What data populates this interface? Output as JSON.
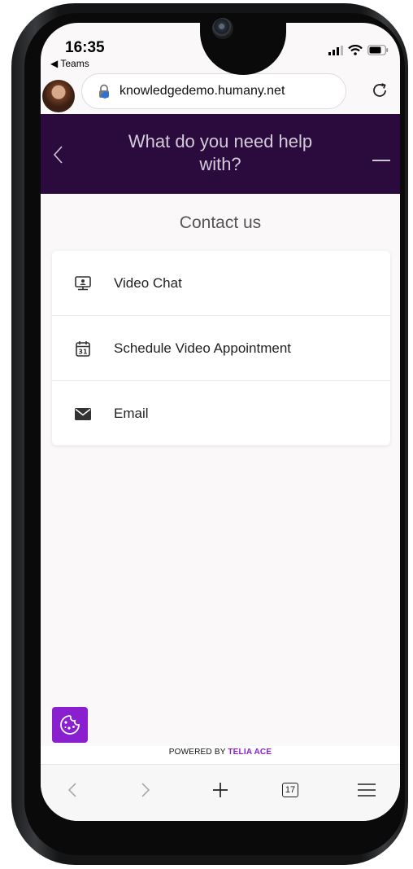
{
  "status_bar": {
    "time": "16:35",
    "back_app": "◀ Teams"
  },
  "browser": {
    "url": "knowledgedemo.humany.net",
    "tab_count": "17"
  },
  "header": {
    "title": "What do you need help with?"
  },
  "contact": {
    "title": "Contact us",
    "options": [
      {
        "label": "Video Chat",
        "icon": "video-chat-icon"
      },
      {
        "label": "Schedule Video Appointment",
        "icon": "calendar-icon"
      },
      {
        "label": "Email",
        "icon": "envelope-icon"
      }
    ]
  },
  "footer": {
    "powered_prefix": "POWERED BY ",
    "powered_brand": "TELIA ACE"
  },
  "colors": {
    "header_bg": "#2b0a3d",
    "accent": "#8a1fd0",
    "page_bg": "#faf8f8"
  }
}
